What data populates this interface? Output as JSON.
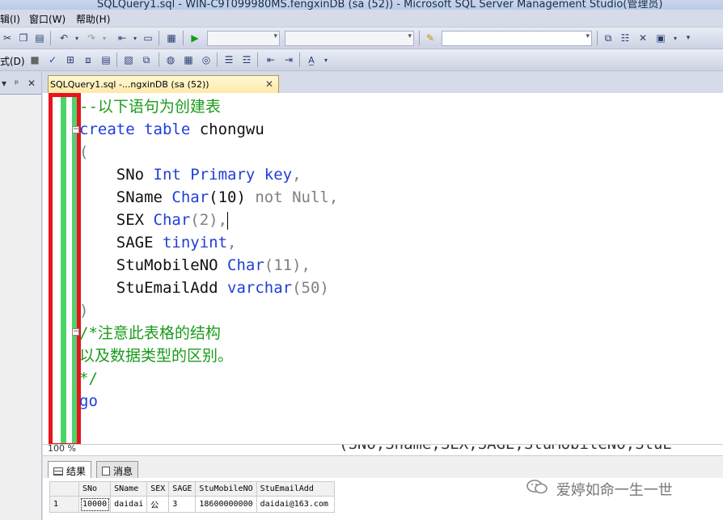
{
  "window": {
    "title": "SQLQuery1.sql - WIN-C9T099980MS.fengxinDB (sa (52)) - Microsoft SQL Server Management Studio(管理员)"
  },
  "menu": {
    "items": [
      "辑(I)",
      "窗口(W)",
      "帮助(H)"
    ]
  },
  "toolbar2": {
    "left_label": "式(D)"
  },
  "left_pane": {
    "pin": "ᵖ",
    "close": "✕",
    "dropdown": "▾"
  },
  "doc_tab": {
    "label": "SQLQuery1.sql -...ngxinDB (sa (52))",
    "close": "✕"
  },
  "code": {
    "line1": "--以下语句为创建表",
    "line2_kw": "create table",
    "line2_name": " chongwu",
    "line3": "(",
    "line4a": "    SNo ",
    "line4b": "Int Primary key",
    "line4c": ",",
    "line5a": "    SName ",
    "line5b": "Char",
    "line5c": "(10) ",
    "line5d": "not Null",
    "line5e": ",",
    "line6a": "    SEX ",
    "line6b": "Char",
    "line6c": "(2),",
    "line7a": "    SAGE ",
    "line7b": "tinyint",
    "line7c": ",",
    "line8a": "    StuMobileNO ",
    "line8b": "Char",
    "line8c": "(11),",
    "line9a": "    StuEmailAdd ",
    "line9b": "varchar",
    "line9c": "(50)",
    "line10": ")",
    "line11": "/*注意此表格的结构",
    "line12": "以及数据类型的区别。",
    "line13": "*/",
    "line14": "go",
    "cut_line": "                                (SNO,Sname,SEX,SAGE,StuMobileNO,StuE"
  },
  "status": {
    "zoom": "100 %"
  },
  "results_tabs": {
    "results": "结果",
    "messages": "消息"
  },
  "results": {
    "columns": [
      "SNo",
      "SName",
      "SEX",
      "SAGE",
      "StuMobileNO",
      "StuEmailAdd"
    ],
    "rows": [
      {
        "rownum": "1",
        "cells": [
          "10000",
          "daidai",
          "公",
          "3",
          "18600000000",
          "daidai@163.com"
        ]
      }
    ]
  },
  "watermark": {
    "text": "爱婷如命一生一世"
  }
}
